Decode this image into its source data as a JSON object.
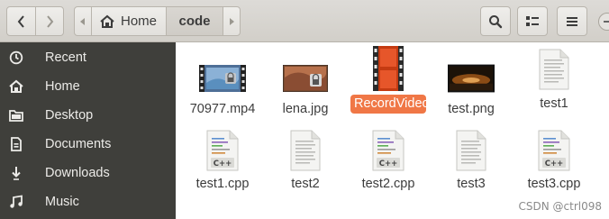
{
  "header": {
    "home_label": "Home",
    "current_folder": "code"
  },
  "sidebar": {
    "items": [
      {
        "label": "Recent",
        "icon": "clock-icon"
      },
      {
        "label": "Home",
        "icon": "home-icon"
      },
      {
        "label": "Desktop",
        "icon": "folder-icon"
      },
      {
        "label": "Documents",
        "icon": "document-icon"
      },
      {
        "label": "Downloads",
        "icon": "download-icon"
      },
      {
        "label": "Music",
        "icon": "music-icon"
      }
    ]
  },
  "files": [
    {
      "name": "70977.mp4",
      "type": "video"
    },
    {
      "name": "lena.jpg",
      "type": "image-locked"
    },
    {
      "name": "RecordVideo.avi",
      "type": "video",
      "selected": true
    },
    {
      "name": "test.png",
      "type": "image"
    },
    {
      "name": "test1",
      "type": "binary"
    },
    {
      "name": "test1.cpp",
      "type": "cpp"
    },
    {
      "name": "test2",
      "type": "binary"
    },
    {
      "name": "test2.cpp",
      "type": "cpp"
    },
    {
      "name": "test3",
      "type": "binary"
    },
    {
      "name": "test3.cpp",
      "type": "cpp"
    }
  ],
  "watermark": "CSDN @ctrl098",
  "colors": {
    "selection": "#f07746",
    "sidebar_bg": "#3f3f3b",
    "header_bg": "#d6d3ce"
  }
}
